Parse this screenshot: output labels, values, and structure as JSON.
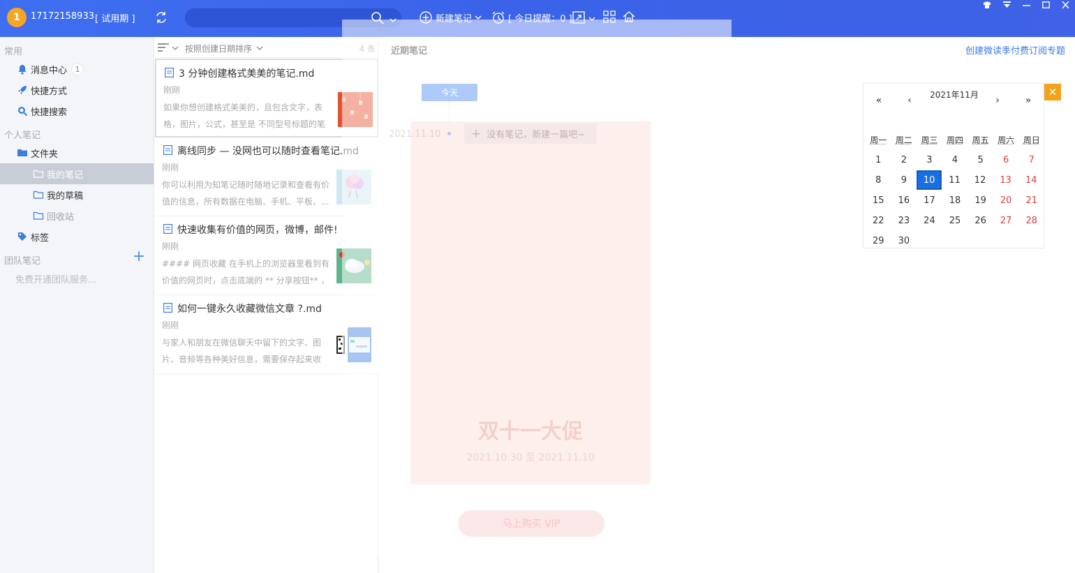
{
  "topbar": {
    "avatar_text": "1",
    "account": "17172158933",
    "trial": "[ 试用期 ]",
    "new_note": "新建笔记",
    "reminder": "[ 今日提醒：0 ]"
  },
  "sidebar": {
    "section_common": "常用",
    "messages": "消息中心",
    "messages_badge": "1",
    "shortcuts": "快捷方式",
    "quick_search": "快捷搜索",
    "section_personal": "个人笔记",
    "folders": "文件夹",
    "my_notes": "我的笔记",
    "my_drafts": "我的草稿",
    "recycle": "回收站",
    "tags": "标签",
    "section_team": "团队笔记",
    "team_hint": "免费开通团队服务..."
  },
  "list": {
    "sort_label": "按照创建日期排序",
    "count": "4 条",
    "notes": [
      {
        "title": "3 分钟创建格式美美的笔记.md",
        "time": "刚刚",
        "snippet": "如果你想创建格式美美的，且包含文字，表格，图片，公式，甚至是 不同型号标题的笔记..."
      },
      {
        "title": "离线同步 — 没网也可以随时查看笔记.md",
        "time": "刚刚",
        "snippet": "你可以利用为知笔记随时随地记录和查看有价值的信息，所有数据在电脑、手机、平板、..."
      },
      {
        "title": "快速收集有价值的网页，微博，邮件!",
        "time": "刚刚",
        "snippet": " #### 网页收藏 在手机上的浏览器里看到有价值的网页时，点击底端的 ** 分享按钮** ，选..."
      },
      {
        "title": "如何一键永久收藏微信文章 ?.md",
        "time": "刚刚",
        "snippet": " 与家人和朋友在微信聊天中留下的文字、图片、音频等各种美好信息，需要保存起来收好? ..."
      }
    ]
  },
  "main": {
    "title": "近期笔记",
    "promo_link": "创建微读季付费订阅专题",
    "today_button": "今天",
    "timeline_date": "2021.11.10",
    "empty_note": "没有笔记，新建一篇吧~",
    "empty_note_plus": "+"
  },
  "calendar": {
    "nav_prev_year": "«",
    "nav_prev_month": "‹",
    "nav_next_month": "›",
    "nav_next_year": "»",
    "title": "2021年11月",
    "weekdays": [
      "周一",
      "周二",
      "周三",
      "周四",
      "周五",
      "周六",
      "周日"
    ],
    "weeks": [
      [
        "1",
        "2",
        "3",
        "4",
        "5",
        "6",
        "7"
      ],
      [
        "8",
        "9",
        "10",
        "11",
        "12",
        "13",
        "14"
      ],
      [
        "15",
        "16",
        "17",
        "18",
        "19",
        "20",
        "21"
      ],
      [
        "22",
        "23",
        "24",
        "25",
        "26",
        "27",
        "28"
      ],
      [
        "29",
        "30",
        "",
        "",
        "",
        "",
        ""
      ]
    ],
    "selected_day": "10",
    "close": "✕"
  },
  "overlay": {
    "promo_title": "双十一大促",
    "promo_dates": "2021.10.30 至 2021.11.10",
    "promo_button": "马上购买 VIP"
  },
  "colors": {
    "accent": "#3f6ff0",
    "selected_day": "#1a6fe0",
    "weekend": "#d9403a",
    "close_button": "#f5a21b"
  }
}
